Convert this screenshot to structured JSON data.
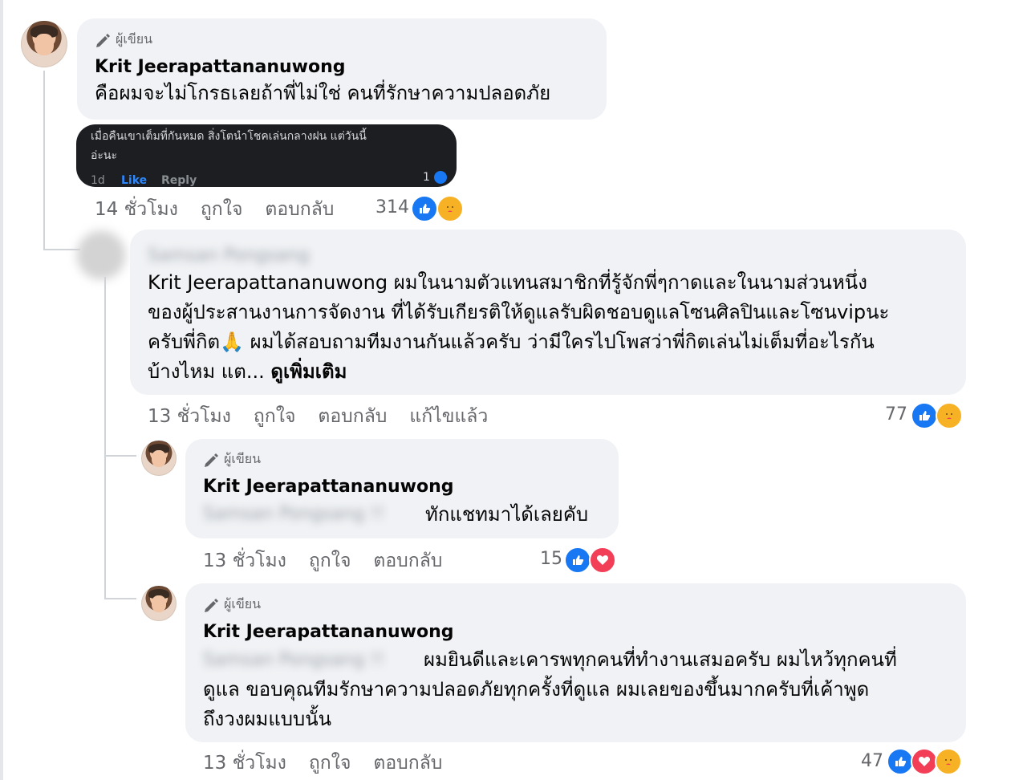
{
  "comment1": {
    "author_badge": "ผู้เขียน",
    "name": "Krit Jeerapattananuwong",
    "text": "คือผมจะไม่โกรธเลยถ้าพี่ไม่ใช่ คนที่รักษาความปลอดภัย",
    "embedded": {
      "line1": "เมื่อคืนเขาเต็มที่กันหมด สิ่งโตนำโชคเล่นกลางฝน แต่วันนี้",
      "line2": "อ่ะนะ",
      "time": "1d",
      "like": "Like",
      "reply": "Reply",
      "count": "1"
    },
    "meta": {
      "time": "14 ชั่วโมง",
      "like": "ถูกใจ",
      "reply": "ตอบกลับ"
    },
    "reaction_count": "314"
  },
  "comment2": {
    "blurred_name": "Samsan Pongsang",
    "text_line1": "Krit Jeerapattananuwong ผมในนามตัวแทนสมาชิกที่รู้จักพี่ๆกาดและในนามส่วนหนึ่ง",
    "text_line2": "ของผู้ประสานงานการจัดงาน ที่ได้รับเกียรติให้ดูแลรับผิดชอบดูแลโซนศิลปินและโซนvipนะ",
    "text_line3": "ครับพี่กิต🙏 ผมได้สอบถามทีมงานกันแล้วครับ ว่ามีใครไปโพสว่าพี่กิตเล่นไม่เต็มที่อะไรกัน",
    "text_line4": "บ้างไหม แต...",
    "see_more": "ดูเพิ่มเติม",
    "meta": {
      "time": "13 ชั่วโมง",
      "like": "ถูกใจ",
      "reply": "ตอบกลับ",
      "edited": "แก้ไขแล้ว"
    },
    "reaction_count": "77"
  },
  "reply1": {
    "author_badge": "ผู้เขียน",
    "name": "Krit Jeerapattananuwong",
    "blurred_mention": "Samsan Pongsang !!",
    "text": "ทักแชทมาได้เลยคับ",
    "meta": {
      "time": "13 ชั่วโมง",
      "like": "ถูกใจ",
      "reply": "ตอบกลับ"
    },
    "reaction_count": "15"
  },
  "reply2": {
    "author_badge": "ผู้เขียน",
    "name": "Krit Jeerapattananuwong",
    "blurred_mention": "Samsan Pongsang !!",
    "text_line1": "ผมยินดีและเคารพทุกคนที่ทำงานเสมอครับ ผมไหว้ทุกคนที่",
    "text_line2": "ดูแล ขอบคุณทีมรักษาความปลอดภัยทุกครั้งที่ดูแล ผมเลยของขึ้นมากครับที่เค้าพูด",
    "text_line3": "ถึงวงผมแบบนั้น",
    "meta": {
      "time": "13 ชั่วโมง",
      "like": "ถูกใจ",
      "reply": "ตอบกลับ"
    },
    "reaction_count": "47"
  },
  "colors": {
    "bubble": "#f0f2f5",
    "meta": "#65676b",
    "like": "#1877f2",
    "love": "#f33e58",
    "care": "#f7b125"
  }
}
